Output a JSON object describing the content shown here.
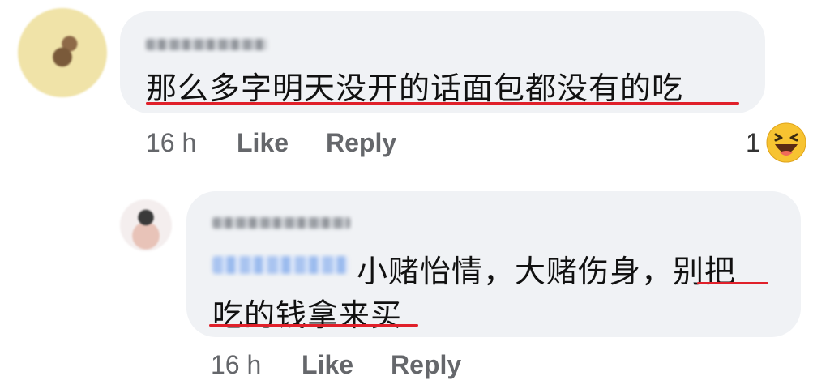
{
  "comments": [
    {
      "text": "那么多字明天没开的话面包都没有的吃",
      "timestamp": "16 h",
      "like_label": "Like",
      "reply_label": "Reply",
      "reaction": {
        "count": "1",
        "type": "haha-emoji"
      }
    },
    {
      "text_line1": "小赌怡情，大赌伤身，别把",
      "text_line2": "吃的钱拿来买",
      "timestamp": "16 h",
      "like_label": "Like",
      "reply_label": "Reply"
    }
  ],
  "colors": {
    "bubble": "#f0f2f5",
    "underline": "#e0202a",
    "meta_text": "#65676b"
  }
}
